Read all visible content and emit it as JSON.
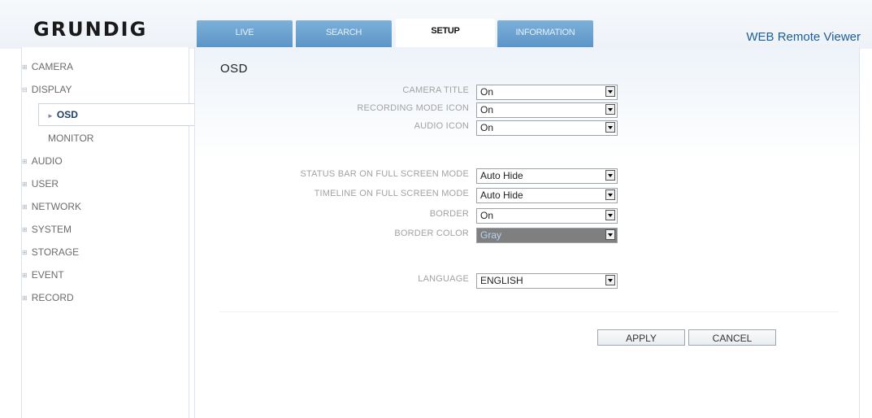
{
  "header": {
    "logo": "GRUNDIG",
    "app_title": "WEB Remote Viewer",
    "tabs": [
      {
        "label": "LIVE",
        "active": false
      },
      {
        "label": "SEARCH",
        "active": false
      },
      {
        "label": "SETUP",
        "active": true
      },
      {
        "label": "INFORMATION",
        "active": false
      }
    ]
  },
  "sidebar": {
    "items": [
      {
        "label": "CAMERA",
        "type": "group"
      },
      {
        "label": "DISPLAY",
        "type": "group"
      },
      {
        "label": "OSD",
        "type": "sub",
        "active": true
      },
      {
        "label": "MONITOR",
        "type": "sub"
      },
      {
        "label": "AUDIO",
        "type": "group"
      },
      {
        "label": "USER",
        "type": "group"
      },
      {
        "label": "NETWORK",
        "type": "group"
      },
      {
        "label": "SYSTEM",
        "type": "group"
      },
      {
        "label": "STORAGE",
        "type": "group"
      },
      {
        "label": "EVENT",
        "type": "group"
      },
      {
        "label": "RECORD",
        "type": "group"
      }
    ]
  },
  "main": {
    "title": "OSD",
    "settings": [
      {
        "label": "CAMERA TITLE",
        "value": "On"
      },
      {
        "label": "RECORDING MODE ICON",
        "value": "On"
      },
      {
        "label": "AUDIO ICON",
        "value": "On"
      },
      {
        "label": "STATUS BAR ON FULL SCREEN MODE",
        "value": "Auto Hide"
      },
      {
        "label": "TIMELINE ON FULL SCREEN MODE",
        "value": "Auto Hide"
      },
      {
        "label": "BORDER",
        "value": "On"
      },
      {
        "label": "BORDER COLOR",
        "value": "Gray"
      },
      {
        "label": "LANGUAGE",
        "value": "ENGLISH"
      }
    ],
    "apply_label": "APPLY",
    "cancel_label": "CANCEL"
  },
  "colors": {
    "tab_inactive": "#6fa3d2",
    "brand_title": "#1d5d98",
    "border_color_swatch": "#7f7f7f"
  }
}
